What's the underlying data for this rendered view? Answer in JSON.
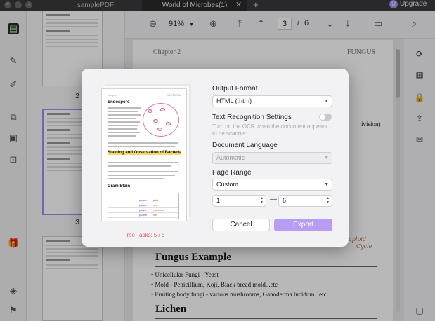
{
  "titlebar": {
    "tabs": [
      {
        "label": "samplePDF",
        "active": false
      },
      {
        "label": "World of Microbes(1)",
        "active": true
      }
    ],
    "close_glyph": "✕",
    "new_tab_glyph": "+",
    "avatar_initial": "U",
    "upgrade_label": "Upgrade"
  },
  "toolbar": {
    "zoom": "91%",
    "current_page": "3",
    "separator": "/",
    "total_pages": "6"
  },
  "thumbnails": {
    "pages": [
      "2",
      "3"
    ]
  },
  "document": {
    "header_left": "Chapter 2",
    "header_right": "FUNGUS",
    "side_fragment": "ivision)",
    "hand_note_1": "aploid",
    "hand_note_2": "Cycle",
    "fungus_heading": "Fungus Example",
    "fungus_items": [
      "Unicellular Fungi - Yeast",
      "Mold - Penicillium, Koji, Black bread mold...etc",
      "Fruiting body fungi - various mushrooms, Ganoderma lucidum...etc"
    ],
    "lichen_heading": "Lichen"
  },
  "dialog": {
    "output_format_label": "Output Format",
    "output_format_value": "HTML (.htm)",
    "text_recognition_label": "Text Recognition Settings",
    "text_recognition_enabled": false,
    "ocr_hint": "Turn on the OCR when the document appears to be scanned.",
    "document_language_label": "Document Language",
    "document_language_value": "Automatic",
    "page_range_label": "Page Range",
    "page_range_value": "Custom",
    "range_from": "1",
    "range_to": "6",
    "range_dash": "—",
    "cancel_label": "Cancel",
    "export_label": "Export",
    "free_tasks": "Free Tasks: 5 / 5",
    "preview": {
      "header_left": "Chapter 1",
      "header_right": "BACTERIA",
      "title_1": "Endospore",
      "title_2": "Staining and Observation of Bacteria",
      "title_3": "Gram Stain",
      "table_values": [
        "purple",
        "purple",
        "purple",
        "purple"
      ],
      "table_values_red": [
        "pink",
        "red",
        "colorless",
        "red"
      ]
    }
  },
  "colors": {
    "accent": "#a58bf2",
    "export_button": "#b79df3",
    "free_tasks": "#e05a5a",
    "dark_chrome": "#3a3a3c"
  }
}
